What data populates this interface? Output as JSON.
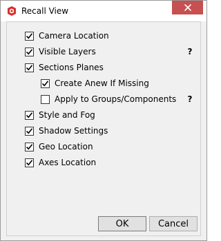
{
  "window": {
    "title": "Recall View",
    "app_icon": "sketchup-icon",
    "close_icon": "close-icon",
    "close_color": "#c75050"
  },
  "options": [
    {
      "id": "camera-location",
      "label": "Camera Location",
      "checked": true,
      "level": 0,
      "help": ""
    },
    {
      "id": "visible-layers",
      "label": "Visible Layers",
      "checked": true,
      "level": 0,
      "help": "?"
    },
    {
      "id": "sections-planes",
      "label": "Sections Planes",
      "checked": true,
      "level": 0,
      "help": ""
    },
    {
      "id": "create-anew-if-missing",
      "label": "Create Anew If Missing",
      "checked": true,
      "level": 1,
      "help": ""
    },
    {
      "id": "apply-to-groups-components",
      "label": "Apply to Groups/Components",
      "checked": false,
      "level": 1,
      "help": "?"
    },
    {
      "id": "style-and-fog",
      "label": "Style and Fog",
      "checked": true,
      "level": 0,
      "help": ""
    },
    {
      "id": "shadow-settings",
      "label": "Shadow Settings",
      "checked": true,
      "level": 0,
      "help": ""
    },
    {
      "id": "geo-location",
      "label": "Geo Location",
      "checked": true,
      "level": 0,
      "help": ""
    },
    {
      "id": "axes-location",
      "label": "Axes Location",
      "checked": true,
      "level": 0,
      "help": ""
    }
  ],
  "buttons": {
    "ok": "OK",
    "cancel": "Cancel"
  }
}
